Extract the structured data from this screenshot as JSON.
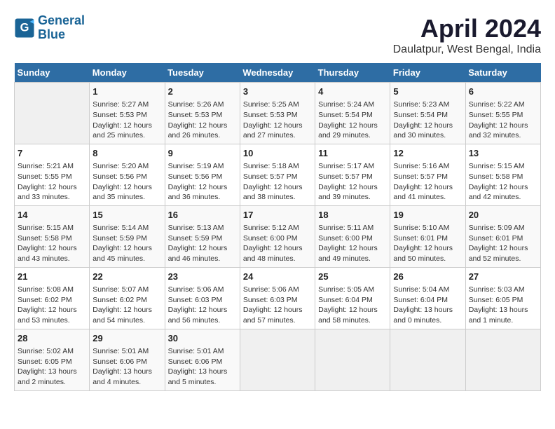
{
  "header": {
    "logo_line1": "General",
    "logo_line2": "Blue",
    "title": "April 2024",
    "subtitle": "Daulatpur, West Bengal, India"
  },
  "columns": [
    "Sunday",
    "Monday",
    "Tuesday",
    "Wednesday",
    "Thursday",
    "Friday",
    "Saturday"
  ],
  "rows": [
    [
      {
        "day": "",
        "info": ""
      },
      {
        "day": "1",
        "info": "Sunrise: 5:27 AM\nSunset: 5:53 PM\nDaylight: 12 hours\nand 25 minutes."
      },
      {
        "day": "2",
        "info": "Sunrise: 5:26 AM\nSunset: 5:53 PM\nDaylight: 12 hours\nand 26 minutes."
      },
      {
        "day": "3",
        "info": "Sunrise: 5:25 AM\nSunset: 5:53 PM\nDaylight: 12 hours\nand 27 minutes."
      },
      {
        "day": "4",
        "info": "Sunrise: 5:24 AM\nSunset: 5:54 PM\nDaylight: 12 hours\nand 29 minutes."
      },
      {
        "day": "5",
        "info": "Sunrise: 5:23 AM\nSunset: 5:54 PM\nDaylight: 12 hours\nand 30 minutes."
      },
      {
        "day": "6",
        "info": "Sunrise: 5:22 AM\nSunset: 5:55 PM\nDaylight: 12 hours\nand 32 minutes."
      }
    ],
    [
      {
        "day": "7",
        "info": "Sunrise: 5:21 AM\nSunset: 5:55 PM\nDaylight: 12 hours\nand 33 minutes."
      },
      {
        "day": "8",
        "info": "Sunrise: 5:20 AM\nSunset: 5:56 PM\nDaylight: 12 hours\nand 35 minutes."
      },
      {
        "day": "9",
        "info": "Sunrise: 5:19 AM\nSunset: 5:56 PM\nDaylight: 12 hours\nand 36 minutes."
      },
      {
        "day": "10",
        "info": "Sunrise: 5:18 AM\nSunset: 5:57 PM\nDaylight: 12 hours\nand 38 minutes."
      },
      {
        "day": "11",
        "info": "Sunrise: 5:17 AM\nSunset: 5:57 PM\nDaylight: 12 hours\nand 39 minutes."
      },
      {
        "day": "12",
        "info": "Sunrise: 5:16 AM\nSunset: 5:57 PM\nDaylight: 12 hours\nand 41 minutes."
      },
      {
        "day": "13",
        "info": "Sunrise: 5:15 AM\nSunset: 5:58 PM\nDaylight: 12 hours\nand 42 minutes."
      }
    ],
    [
      {
        "day": "14",
        "info": "Sunrise: 5:15 AM\nSunset: 5:58 PM\nDaylight: 12 hours\nand 43 minutes."
      },
      {
        "day": "15",
        "info": "Sunrise: 5:14 AM\nSunset: 5:59 PM\nDaylight: 12 hours\nand 45 minutes."
      },
      {
        "day": "16",
        "info": "Sunrise: 5:13 AM\nSunset: 5:59 PM\nDaylight: 12 hours\nand 46 minutes."
      },
      {
        "day": "17",
        "info": "Sunrise: 5:12 AM\nSunset: 6:00 PM\nDaylight: 12 hours\nand 48 minutes."
      },
      {
        "day": "18",
        "info": "Sunrise: 5:11 AM\nSunset: 6:00 PM\nDaylight: 12 hours\nand 49 minutes."
      },
      {
        "day": "19",
        "info": "Sunrise: 5:10 AM\nSunset: 6:01 PM\nDaylight: 12 hours\nand 50 minutes."
      },
      {
        "day": "20",
        "info": "Sunrise: 5:09 AM\nSunset: 6:01 PM\nDaylight: 12 hours\nand 52 minutes."
      }
    ],
    [
      {
        "day": "21",
        "info": "Sunrise: 5:08 AM\nSunset: 6:02 PM\nDaylight: 12 hours\nand 53 minutes."
      },
      {
        "day": "22",
        "info": "Sunrise: 5:07 AM\nSunset: 6:02 PM\nDaylight: 12 hours\nand 54 minutes."
      },
      {
        "day": "23",
        "info": "Sunrise: 5:06 AM\nSunset: 6:03 PM\nDaylight: 12 hours\nand 56 minutes."
      },
      {
        "day": "24",
        "info": "Sunrise: 5:06 AM\nSunset: 6:03 PM\nDaylight: 12 hours\nand 57 minutes."
      },
      {
        "day": "25",
        "info": "Sunrise: 5:05 AM\nSunset: 6:04 PM\nDaylight: 12 hours\nand 58 minutes."
      },
      {
        "day": "26",
        "info": "Sunrise: 5:04 AM\nSunset: 6:04 PM\nDaylight: 13 hours\nand 0 minutes."
      },
      {
        "day": "27",
        "info": "Sunrise: 5:03 AM\nSunset: 6:05 PM\nDaylight: 13 hours\nand 1 minute."
      }
    ],
    [
      {
        "day": "28",
        "info": "Sunrise: 5:02 AM\nSunset: 6:05 PM\nDaylight: 13 hours\nand 2 minutes."
      },
      {
        "day": "29",
        "info": "Sunrise: 5:01 AM\nSunset: 6:06 PM\nDaylight: 13 hours\nand 4 minutes."
      },
      {
        "day": "30",
        "info": "Sunrise: 5:01 AM\nSunset: 6:06 PM\nDaylight: 13 hours\nand 5 minutes."
      },
      {
        "day": "",
        "info": ""
      },
      {
        "day": "",
        "info": ""
      },
      {
        "day": "",
        "info": ""
      },
      {
        "day": "",
        "info": ""
      }
    ]
  ]
}
